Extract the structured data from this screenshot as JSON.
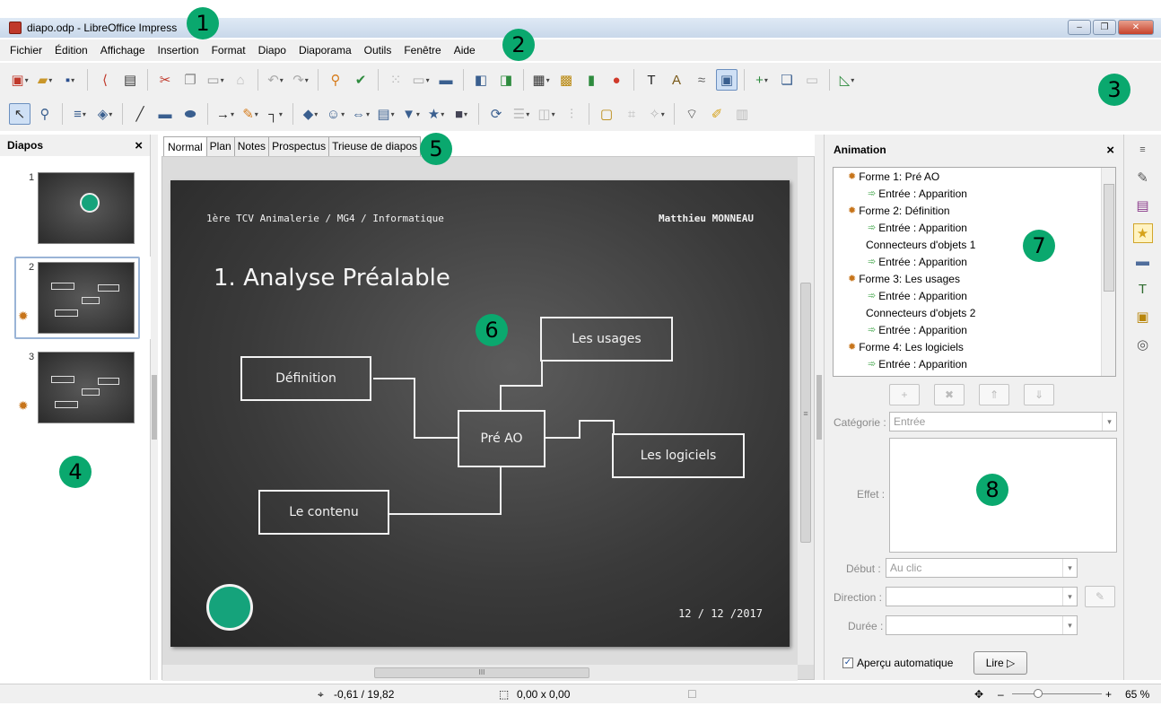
{
  "window": {
    "title": "diapo.odp - LibreOffice Impress",
    "minimize": "–",
    "restore": "❐",
    "close": "✕"
  },
  "menu": [
    "Fichier",
    "Édition",
    "Affichage",
    "Insertion",
    "Format",
    "Diapo",
    "Diaporama",
    "Outils",
    "Fenêtre",
    "Aide"
  ],
  "badges": {
    "b1": "1",
    "b2": "2",
    "b3": "3",
    "b4": "4",
    "b5": "5",
    "b6": "6",
    "b7": "7",
    "b8": "8"
  },
  "slides_pane": {
    "title": "Diapos",
    "close": "×",
    "numbers": [
      "1",
      "2",
      "3"
    ]
  },
  "view_tabs": [
    "Normal",
    "Plan",
    "Notes",
    "Prospectus",
    "Trieuse de diapos"
  ],
  "slide": {
    "header_left": "1ère TCV Animalerie / MG4 / Informatique",
    "header_right": "Matthieu MONNEAU",
    "title": "1. Analyse Préalable",
    "boxes": {
      "definition": "Définition",
      "pre_ao": "Pré AO",
      "usages": "Les usages",
      "logiciels": "Les logiciels",
      "contenu": "Le contenu"
    },
    "date": "12 / 12 /2017"
  },
  "scroll": {
    "hgrip": "III",
    "vgrip": "≡"
  },
  "animation_panel": {
    "title": "Animation",
    "close": "×",
    "list": [
      {
        "kind": "shape",
        "text": "Forme 1: Pré AO"
      },
      {
        "kind": "effect",
        "text": "Entrée : Apparition"
      },
      {
        "kind": "shape",
        "text": "Forme 2: Définition"
      },
      {
        "kind": "effect",
        "text": "Entrée : Apparition"
      },
      {
        "kind": "conn",
        "text": "Connecteurs d'objets 1"
      },
      {
        "kind": "effect",
        "text": "Entrée : Apparition"
      },
      {
        "kind": "shape",
        "text": "Forme 3: Les usages"
      },
      {
        "kind": "effect",
        "text": "Entrée : Apparition"
      },
      {
        "kind": "conn",
        "text": "Connecteurs d'objets 2"
      },
      {
        "kind": "effect",
        "text": "Entrée : Apparition"
      },
      {
        "kind": "shape",
        "text": "Forme 4: Les logiciels"
      },
      {
        "kind": "effect",
        "text": "Entrée : Apparition"
      }
    ],
    "buttons": {
      "add": "+",
      "remove": "✖",
      "up": "⇑",
      "down": "⇓"
    },
    "category_label": "Catégorie :",
    "category_value": "Entrée",
    "effect_label": "Effet :",
    "start_label": "Début :",
    "start_value": "Au clic",
    "direction_label": "Direction :",
    "direction_value": "",
    "duration_label": "Durée :",
    "duration_value": "",
    "autopreview_label": "Aperçu automatique",
    "autopreview_checked": "✓",
    "play_label": "Lire ▷"
  },
  "statusbar": {
    "position": "-0,61 / 19,82",
    "size": "0,00 x 0,00",
    "zoom": "65 %",
    "minus": "–",
    "plus": "+"
  },
  "colors": {
    "badge": "#0aa86e",
    "slide_bg": "#3a3a3a",
    "accent": "#3a5f8f"
  },
  "icons": {
    "deck": [
      "properties-icon",
      "styles-icon",
      "gallery-icon",
      "animation-icon",
      "master-slides-icon",
      "fontwork-icon",
      "media-icon",
      "navigator-icon"
    ]
  }
}
